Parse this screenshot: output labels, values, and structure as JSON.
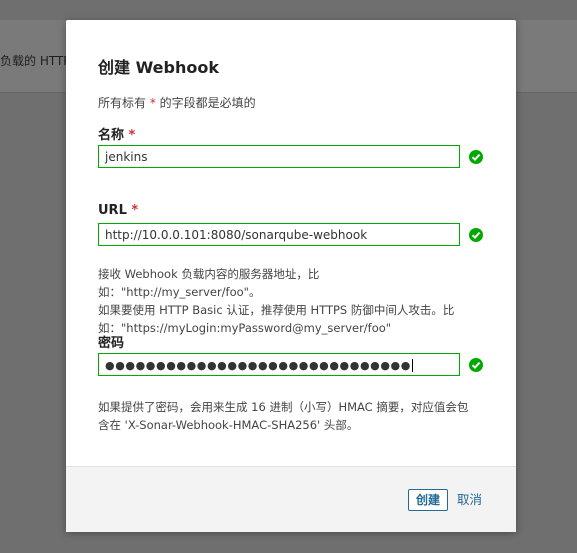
{
  "background": {
    "text": "负载的 HTTP"
  },
  "modal": {
    "title": "创建 Webhook",
    "required_hint_prefix": "所有标有 ",
    "required_hint_star": "*",
    "required_hint_suffix": " 的字段都是必填的",
    "name": {
      "label": "名称",
      "required": "*",
      "value": "jenkins",
      "status": "valid"
    },
    "url": {
      "label": "URL",
      "required": "*",
      "value": "http://10.0.0.101:8080/sonarqube-webhook",
      "status": "valid",
      "help_line1": "接收 Webhook 负载内容的服务器地址，比如：\"http://my_server/foo\"。",
      "help_line2": "如果要使用 HTTP Basic 认证，推荐使用 HTTPS 防御中间人攻击。比",
      "help_line3": "如：\"https://myLogin:myPassword@my_server/foo\""
    },
    "secret": {
      "label": "密码",
      "masked_value": "●●●●●●●●●●●●●●●●●●●●●●●●●●●●●●",
      "status": "valid",
      "help_line1": "如果提供了密码，会用来生成 16 进制（小写）HMAC 摘要，对应值会包",
      "help_line2": "含在 'X-Sonar-Webhook-HMAC-SHA256' 头部。"
    },
    "footer": {
      "create_label": "创建",
      "cancel_label": "取消"
    }
  },
  "colors": {
    "valid_green": "#00aa00",
    "link_blue": "#236a97",
    "required_red": "#d02f3a"
  }
}
